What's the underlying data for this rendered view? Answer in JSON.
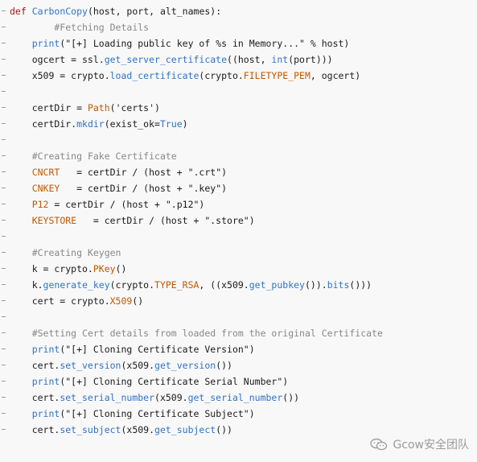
{
  "code_lines": [
    {
      "segments": [
        {
          "t": "def",
          "c": "kw"
        },
        {
          "t": " "
        },
        {
          "t": "CarbonCopy",
          "c": "fn"
        },
        {
          "t": "(host, port, alt_names):"
        }
      ]
    },
    {
      "segments": [
        {
          "t": "        "
        },
        {
          "t": "#Fetching Details",
          "c": "com"
        }
      ]
    },
    {
      "segments": [
        {
          "t": "    "
        },
        {
          "t": "print",
          "c": "fn"
        },
        {
          "t": "(\"[+] Loading public key of %s in Memory...\" % host)"
        }
      ]
    },
    {
      "segments": [
        {
          "t": "    ogcert = ssl."
        },
        {
          "t": "get_server_certificate",
          "c": "fn"
        },
        {
          "t": "((host, "
        },
        {
          "t": "int",
          "c": "fn"
        },
        {
          "t": "(port)))"
        }
      ]
    },
    {
      "segments": [
        {
          "t": "    x509 = crypto."
        },
        {
          "t": "load_certificate",
          "c": "fn"
        },
        {
          "t": "(crypto."
        },
        {
          "t": "FILETYPE_PEM",
          "c": "cst"
        },
        {
          "t": ", ogcert)"
        }
      ]
    },
    {
      "segments": [
        {
          "t": ""
        }
      ]
    },
    {
      "segments": [
        {
          "t": "    certDir = "
        },
        {
          "t": "Path",
          "c": "cst"
        },
        {
          "t": "('certs')"
        }
      ]
    },
    {
      "segments": [
        {
          "t": "    certDir."
        },
        {
          "t": "mkdir",
          "c": "fn"
        },
        {
          "t": "(exist_ok="
        },
        {
          "t": "True",
          "c": "fn"
        },
        {
          "t": ")"
        }
      ]
    },
    {
      "segments": [
        {
          "t": ""
        }
      ]
    },
    {
      "segments": [
        {
          "t": "    "
        },
        {
          "t": "#Creating Fake Certificate",
          "c": "com"
        }
      ]
    },
    {
      "segments": [
        {
          "t": "    "
        },
        {
          "t": "CNCRT",
          "c": "var"
        },
        {
          "t": "   = certDir / (host + \".crt\")"
        }
      ]
    },
    {
      "segments": [
        {
          "t": "    "
        },
        {
          "t": "CNKEY",
          "c": "var"
        },
        {
          "t": "   = certDir / (host + \".key\")"
        }
      ]
    },
    {
      "segments": [
        {
          "t": "    "
        },
        {
          "t": "P12",
          "c": "var"
        },
        {
          "t": " = certDir / (host + \".p12\")"
        }
      ]
    },
    {
      "segments": [
        {
          "t": "    "
        },
        {
          "t": "KEYSTORE",
          "c": "var"
        },
        {
          "t": "   = certDir / (host + \".store\")"
        }
      ]
    },
    {
      "segments": [
        {
          "t": ""
        }
      ]
    },
    {
      "segments": [
        {
          "t": "    "
        },
        {
          "t": "#Creating Keygen",
          "c": "com"
        }
      ]
    },
    {
      "segments": [
        {
          "t": "    k = crypto."
        },
        {
          "t": "PKey",
          "c": "cst"
        },
        {
          "t": "()"
        }
      ]
    },
    {
      "segments": [
        {
          "t": "    k."
        },
        {
          "t": "generate_key",
          "c": "fn"
        },
        {
          "t": "(crypto."
        },
        {
          "t": "TYPE_RSA",
          "c": "cst"
        },
        {
          "t": ", ((x509."
        },
        {
          "t": "get_pubkey",
          "c": "fn"
        },
        {
          "t": "())."
        },
        {
          "t": "bits",
          "c": "fn"
        },
        {
          "t": "()))"
        }
      ]
    },
    {
      "segments": [
        {
          "t": "    cert = crypto."
        },
        {
          "t": "X509",
          "c": "cst"
        },
        {
          "t": "()"
        }
      ]
    },
    {
      "segments": [
        {
          "t": ""
        }
      ]
    },
    {
      "segments": [
        {
          "t": "    "
        },
        {
          "t": "#Setting Cert details from loaded from the original Certificate",
          "c": "com"
        }
      ]
    },
    {
      "segments": [
        {
          "t": "    "
        },
        {
          "t": "print",
          "c": "fn"
        },
        {
          "t": "(\"[+] Cloning Certificate Version\")"
        }
      ]
    },
    {
      "segments": [
        {
          "t": "    cert."
        },
        {
          "t": "set_version",
          "c": "fn"
        },
        {
          "t": "(x509."
        },
        {
          "t": "get_version",
          "c": "fn"
        },
        {
          "t": "())"
        }
      ]
    },
    {
      "segments": [
        {
          "t": "    "
        },
        {
          "t": "print",
          "c": "fn"
        },
        {
          "t": "(\"[+] Cloning Certificate Serial Number\")"
        }
      ]
    },
    {
      "segments": [
        {
          "t": "    cert."
        },
        {
          "t": "set_serial_number",
          "c": "fn"
        },
        {
          "t": "(x509."
        },
        {
          "t": "get_serial_number",
          "c": "fn"
        },
        {
          "t": "())"
        }
      ]
    },
    {
      "segments": [
        {
          "t": "    "
        },
        {
          "t": "print",
          "c": "fn"
        },
        {
          "t": "(\"[+] Cloning Certificate Subject\")"
        }
      ]
    },
    {
      "segments": [
        {
          "t": "    cert."
        },
        {
          "t": "set_subject",
          "c": "fn"
        },
        {
          "t": "(x509."
        },
        {
          "t": "get_subject",
          "c": "fn"
        },
        {
          "t": "())"
        }
      ]
    }
  ],
  "watermark": {
    "icon": "wechat-icon",
    "text": "Gcow安全团队"
  },
  "colors": {
    "keyword": "#a31515",
    "function": "#2f73c4",
    "comment": "#888888",
    "constant": "#c05800",
    "background": "#f8f8f8"
  }
}
